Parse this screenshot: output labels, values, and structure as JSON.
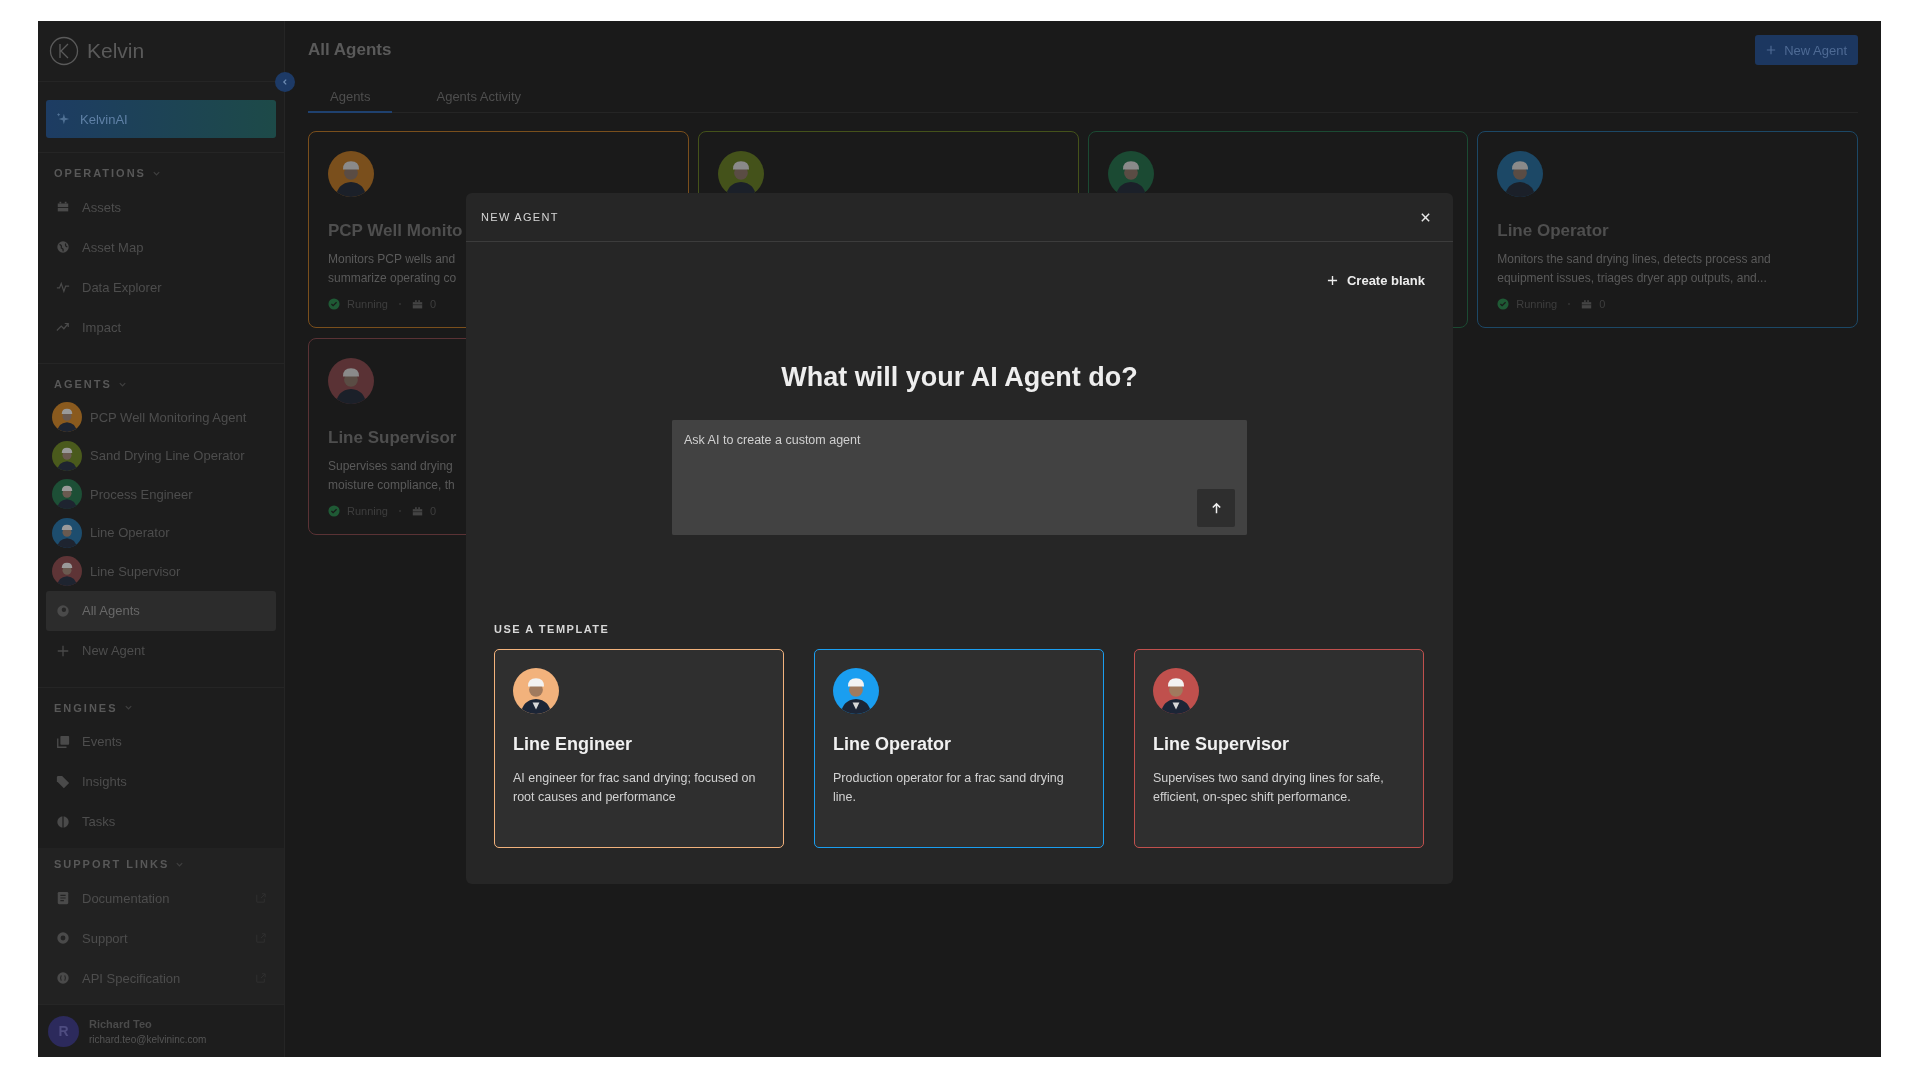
{
  "sidebar": {
    "logo": "Kelvin",
    "ai_button": "KelvinAI",
    "sections": [
      {
        "title": "OPERATIONS",
        "items": [
          {
            "kind": "nav",
            "label": "Assets",
            "selected": false
          },
          {
            "kind": "nav",
            "label": "Asset Map",
            "selected": false
          },
          {
            "kind": "nav",
            "label": "Data Explorer",
            "selected": false
          },
          {
            "kind": "nav",
            "label": "Impact",
            "selected": false
          }
        ]
      },
      {
        "title": "AGENTS",
        "items": [
          {
            "kind": "agent",
            "label": "PCP Well Monitoring Agent",
            "color": "#8a5a1e",
            "selected": false
          },
          {
            "kind": "agent",
            "label": "Sand Drying Line Operator",
            "color": "#4a5a1c",
            "selected": false
          },
          {
            "kind": "agent",
            "label": "Process Engineer",
            "color": "#1d4f36",
            "selected": false
          },
          {
            "kind": "agent",
            "label": "Line Operator",
            "color": "#1d4d6e",
            "selected": false
          },
          {
            "kind": "agent",
            "label": "Line Supervisor",
            "color": "#5e3436",
            "selected": false
          },
          {
            "kind": "nav",
            "label": "All Agents",
            "selected": true
          },
          {
            "kind": "nav",
            "label": "New Agent",
            "selected": false
          }
        ]
      },
      {
        "title": "ENGINES",
        "items": [
          {
            "kind": "nav",
            "label": "Events",
            "selected": false
          },
          {
            "kind": "nav",
            "label": "Insights",
            "selected": false
          },
          {
            "kind": "nav",
            "label": "Tasks",
            "selected": false
          }
        ]
      }
    ],
    "support": {
      "title": "SUPPORT LINKS",
      "items": [
        {
          "label": "Documentation"
        },
        {
          "label": "Support"
        },
        {
          "label": "API Specification"
        }
      ]
    },
    "user": {
      "initial": "R",
      "name": "Richard Teo",
      "email": "richard.teo@kelvininc.com"
    }
  },
  "page": {
    "title": "All Agents",
    "new_button": "New Agent",
    "tabs": [
      {
        "label": "Agents",
        "selected": true
      },
      {
        "label": "Agents Activity",
        "selected": false
      }
    ],
    "cards": [
      {
        "color": "#7a4f1c",
        "title": "PCP Well Monito",
        "description": [
          "Monitors PCP wells and",
          "summarize operating co"
        ],
        "status": "Running",
        "count": "0"
      },
      {
        "color": "#44521a"
      },
      {
        "color": "#1b4a33"
      },
      {
        "color": "#1c4866",
        "title": "Line Operator",
        "description": [
          "Monitors the sand drying lines, detects process and",
          "equipment issues, triages dryer app outputs, and..."
        ],
        "status": "Running",
        "count": "0"
      },
      {
        "color": "#5a3235",
        "title": "Line Supervisor",
        "description": [
          "Supervises sand drying",
          "moisture compliance, th"
        ],
        "status": "Running",
        "count": "0"
      }
    ]
  },
  "modal": {
    "title": "NEW AGENT",
    "create_blank": "Create blank",
    "heading": "What will your AI Agent do?",
    "prompt_placeholder": "Ask AI to create a custom agent",
    "template_heading": "USE A TEMPLATE",
    "templates": [
      {
        "color": "#f2b27c",
        "title": "Line Engineer",
        "description": "AI engineer for frac sand drying; focused on root causes and performance"
      },
      {
        "color": "#1a9ef0",
        "title": "Line Operator",
        "description": "Production operator for a frac sand drying line."
      },
      {
        "color": "#c0504d",
        "title": "Line Supervisor",
        "description": "Supervises two sand drying lines for safe, efficient, on-spec shift performance."
      }
    ]
  }
}
